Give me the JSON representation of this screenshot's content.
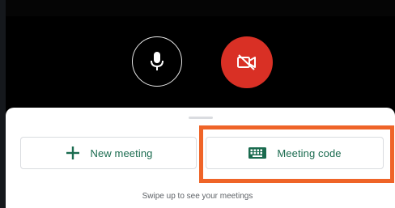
{
  "controls": {
    "mic_icon": "microphone-icon",
    "camera_icon": "camera-off-icon"
  },
  "actions": {
    "new_meeting_label": "New meeting",
    "new_meeting_icon": "plus-icon",
    "meeting_code_label": "Meeting code",
    "meeting_code_icon": "keyboard-icon"
  },
  "hint_text": "Swipe up to see your meetings",
  "colors": {
    "accent_green": "#1a6b4f",
    "camera_off_red": "#d93025",
    "highlight_orange": "#ef6428"
  }
}
